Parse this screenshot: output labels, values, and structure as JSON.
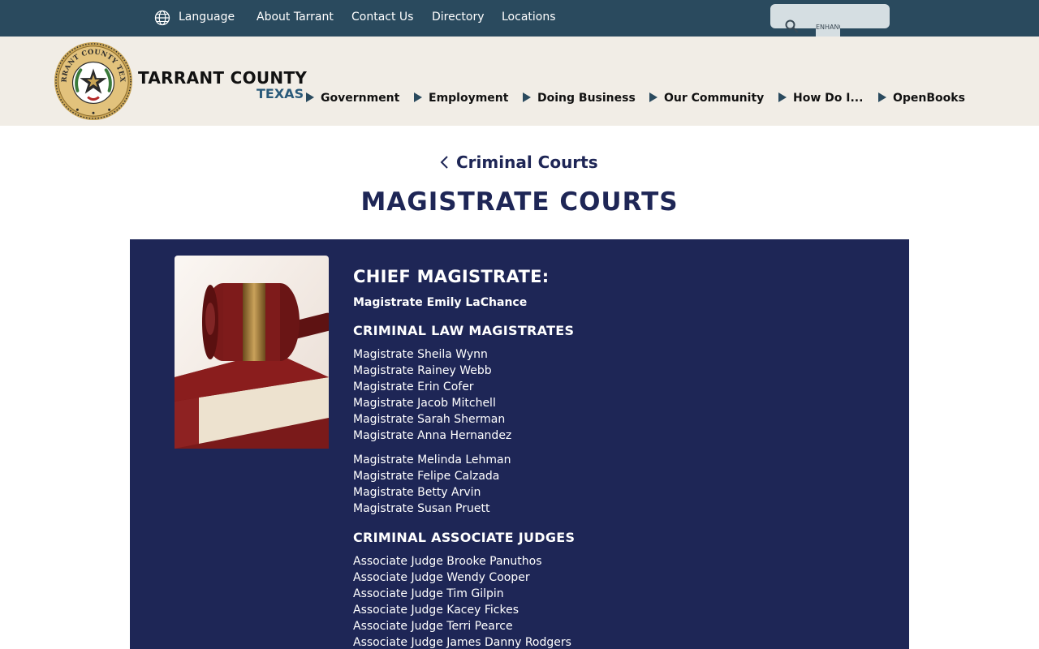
{
  "topbar": {
    "language_label": "Language",
    "links": [
      "About Tarrant",
      "Contact Us",
      "Directory",
      "Locations"
    ],
    "enhance_label": "ENHANCE"
  },
  "brand": {
    "name": "TARRANT COUNTY",
    "state": "TEXAS",
    "seal_text": "TARRANT COUNTY TEXAS"
  },
  "nav": {
    "items": [
      "Government",
      "Employment",
      "Doing Business",
      "Our Community",
      "How Do I...",
      "OpenBooks"
    ]
  },
  "breadcrumb": {
    "back_label": "Criminal Courts"
  },
  "page": {
    "title": "MAGISTRATE COURTS"
  },
  "panel": {
    "chief_heading": "CHIEF MAGISTRATE:",
    "chief_name": "Magistrate Emily LaChance",
    "criminal_heading": "CRIMINAL LAW MAGISTRATES",
    "criminal_group_1": [
      "Magistrate Sheila Wynn",
      "Magistrate Rainey Webb",
      "Magistrate Erin Cofer",
      "Magistrate Jacob Mitchell",
      "Magistrate Sarah Sherman",
      "Magistrate Anna Hernandez"
    ],
    "criminal_group_2": [
      "Magistrate Melinda Lehman",
      "Magistrate Felipe Calzada",
      "Magistrate Betty Arvin",
      "Magistrate Susan Pruett"
    ],
    "associate_heading": "CRIMINAL ASSOCIATE JUDGES",
    "associate_judges": [
      "Associate Judge Brooke Panuthos",
      "Associate Judge Wendy Cooper",
      "Associate Judge Tim Gilpin",
      "Associate Judge Kacey Fickes",
      "Associate Judge Terri Pearce",
      "Associate Judge James Danny Rodgers"
    ]
  },
  "colors": {
    "topbar": "#2a4a5e",
    "header": "#f1ede6",
    "navy": "#1e2656",
    "brand_state": "#2a5a7a"
  },
  "icons": {
    "language": "globe-icon",
    "search": "search-icon",
    "back": "chevron-left-icon",
    "nav": "triangle-right-icon"
  }
}
